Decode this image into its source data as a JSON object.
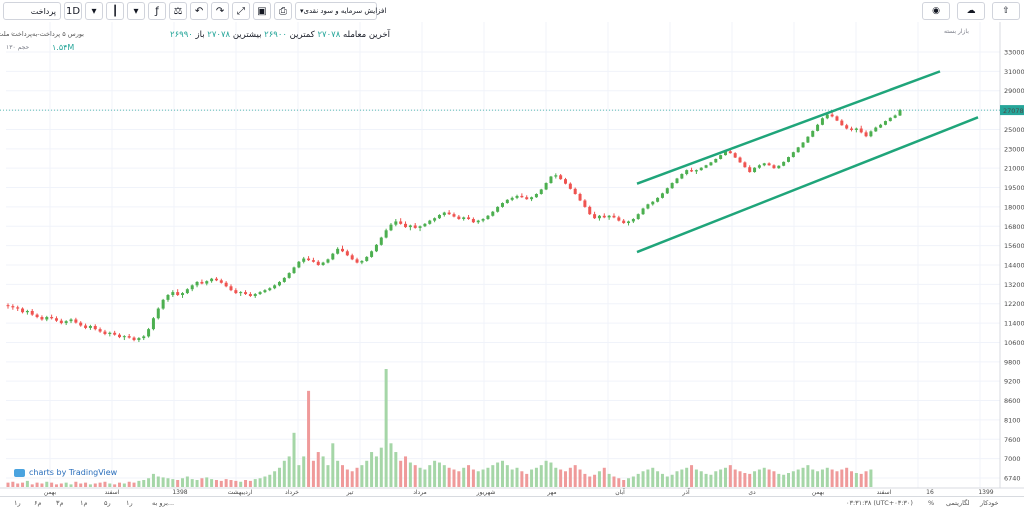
{
  "toolbar": {
    "symbol": "پرداخت",
    "interval": "1D",
    "indicators_label": "افزایش سرمایه و سود نقدی",
    "icons": [
      "chevron-down-icon",
      "candles-icon",
      "indicators-icon",
      "compare-icon",
      "undo-icon",
      "redo-icon",
      "fullscreen-icon",
      "save-icon",
      "print-icon",
      "camera-icon",
      "cloud-icon",
      "cloud-upload-icon"
    ]
  },
  "legend": {
    "symbol_title": "بورس ۵ پرداخت-به‌پرداخت ملت",
    "open_label": "باز",
    "open_value": "۲۶۹۹۰",
    "high_label": "بیشترین",
    "high_value": "۲۷۰۷۸",
    "low_label": "کمترین",
    "low_value": "۲۶۹۰۰",
    "close_label": "آخرین معامله",
    "close_value": "۲۷۰۷۸",
    "market_label": "بازار بسته",
    "volume_label": "حجم ۱۳۰",
    "volume_value": "۱.۵۴M"
  },
  "attribution": "charts by TradingView",
  "bottombar": {
    "ranges": [
      "۱ر",
      "۶م",
      "۳م",
      "۱م",
      "۵ر",
      "۱ر"
    ],
    "goto": "برو به...",
    "time": "۰۳:۳۱:۳۸ (UTC+۰۳:۳۰)",
    "percent": "%",
    "log": "لگاریتمی",
    "auto": "خودکار"
  },
  "chart_data": {
    "type": "candlestick",
    "y_ticks": [
      33000,
      31000,
      29000,
      27078,
      25000,
      23000,
      21000,
      19500,
      18000,
      16800,
      15600,
      14400,
      13200,
      12200,
      11400,
      10600,
      9800,
      9200,
      8600,
      8100,
      7600,
      7000,
      6740
    ],
    "last_price": 27078,
    "x_labels": [
      "بهمن",
      "اسفند",
      "1398",
      "اردیبهشت",
      "خرداد",
      "تیر",
      "مرداد",
      "شهریور",
      "مهر",
      "آبان",
      "آذر",
      "دی",
      "بهمن",
      "اسفند",
      "16",
      "1399"
    ],
    "candles": [
      [
        12140,
        12220,
        12000,
        12100
      ],
      [
        12100,
        12180,
        11950,
        12050
      ],
      [
        12050,
        12120,
        11900,
        12000
      ],
      [
        12000,
        12050,
        11800,
        11850
      ],
      [
        11850,
        11950,
        11750,
        11900
      ],
      [
        11900,
        11980,
        11700,
        11750
      ],
      [
        11750,
        11800,
        11600,
        11650
      ],
      [
        11650,
        11720,
        11500,
        11550
      ],
      [
        11550,
        11700,
        11480,
        11650
      ],
      [
        11650,
        11750,
        11550,
        11600
      ],
      [
        11600,
        11680,
        11450,
        11500
      ],
      [
        11500,
        11580,
        11350,
        11400
      ],
      [
        11400,
        11520,
        11320,
        11480
      ],
      [
        11480,
        11600,
        11400,
        11550
      ],
      [
        11550,
        11620,
        11380,
        11420
      ],
      [
        11420,
        11480,
        11250,
        11300
      ],
      [
        11300,
        11380,
        11150,
        11200
      ],
      [
        11200,
        11330,
        11120,
        11280
      ],
      [
        11280,
        11350,
        11100,
        11150
      ],
      [
        11150,
        11220,
        11000,
        11050
      ],
      [
        11050,
        11120,
        10900,
        10950
      ],
      [
        10950,
        11050,
        10850,
        11000
      ],
      [
        11000,
        11080,
        10880,
        10920
      ],
      [
        10920,
        10980,
        10780,
        10820
      ],
      [
        10820,
        10900,
        10700,
        10860
      ],
      [
        10860,
        10950,
        10760,
        10800
      ],
      [
        10800,
        10850,
        10650,
        10700
      ],
      [
        10700,
        10820,
        10620,
        10780
      ],
      [
        10780,
        10900,
        10700,
        10850
      ],
      [
        10850,
        11200,
        10800,
        11150
      ],
      [
        11150,
        11650,
        11100,
        11600
      ],
      [
        11600,
        12050,
        11550,
        12000
      ],
      [
        12000,
        12450,
        11950,
        12400
      ],
      [
        12400,
        12700,
        12300,
        12650
      ],
      [
        12650,
        12900,
        12550,
        12800
      ],
      [
        12800,
        12950,
        12600,
        12650
      ],
      [
        12650,
        12800,
        12500,
        12750
      ],
      [
        12750,
        13000,
        12700,
        12950
      ],
      [
        12950,
        13200,
        12850,
        13150
      ],
      [
        13150,
        13400,
        13050,
        13350
      ],
      [
        13350,
        13500,
        13200,
        13250
      ],
      [
        13250,
        13450,
        13150,
        13400
      ],
      [
        13400,
        13600,
        13300,
        13550
      ],
      [
        13550,
        13650,
        13400,
        13450
      ],
      [
        13450,
        13550,
        13250,
        13300
      ],
      [
        13300,
        13400,
        13050,
        13100
      ],
      [
        13100,
        13200,
        12850,
        12900
      ],
      [
        12900,
        13000,
        12700,
        12750
      ],
      [
        12750,
        12850,
        12600,
        12800
      ],
      [
        12800,
        12900,
        12650,
        12700
      ],
      [
        12700,
        12800,
        12550,
        12600
      ],
      [
        12600,
        12750,
        12500,
        12700
      ],
      [
        12700,
        12850,
        12650,
        12800
      ],
      [
        12800,
        12950,
        12750,
        12900
      ],
      [
        12900,
        13050,
        12850,
        13000
      ],
      [
        13000,
        13200,
        12950,
        13150
      ],
      [
        13150,
        13400,
        13100,
        13350
      ],
      [
        13350,
        13650,
        13300,
        13600
      ],
      [
        13600,
        13950,
        13550,
        13900
      ],
      [
        13900,
        14300,
        13850,
        14250
      ],
      [
        14250,
        14650,
        14200,
        14600
      ],
      [
        14600,
        14900,
        14500,
        14800
      ],
      [
        14800,
        14950,
        14650,
        14700
      ],
      [
        14700,
        14850,
        14550,
        14600
      ],
      [
        14600,
        14700,
        14350,
        14400
      ],
      [
        14400,
        14600,
        14350,
        14550
      ],
      [
        14550,
        14800,
        14500,
        14750
      ],
      [
        14750,
        15150,
        14700,
        15100
      ],
      [
        15100,
        15500,
        15050,
        15400
      ],
      [
        15400,
        15600,
        15200,
        15250
      ],
      [
        15250,
        15350,
        14950,
        15000
      ],
      [
        15000,
        15100,
        14700,
        14750
      ],
      [
        14750,
        14850,
        14500,
        14550
      ],
      [
        14550,
        14700,
        14450,
        14650
      ],
      [
        14650,
        14950,
        14600,
        14900
      ],
      [
        14900,
        15300,
        14850,
        15250
      ],
      [
        15250,
        15700,
        15200,
        15650
      ],
      [
        15650,
        16150,
        15600,
        16100
      ],
      [
        16100,
        16650,
        16050,
        16550
      ],
      [
        16550,
        17000,
        16500,
        16900
      ],
      [
        16900,
        17250,
        16800,
        17100
      ],
      [
        17100,
        17300,
        16900,
        16950
      ],
      [
        16950,
        17100,
        16700,
        16750
      ],
      [
        16750,
        16900,
        16550,
        16850
      ],
      [
        16850,
        17000,
        16650,
        16700
      ],
      [
        16700,
        16850,
        16500,
        16800
      ],
      [
        16800,
        17000,
        16750,
        16950
      ],
      [
        16950,
        17200,
        16900,
        17150
      ],
      [
        17150,
        17350,
        17050,
        17300
      ],
      [
        17300,
        17550,
        17250,
        17500
      ],
      [
        17500,
        17700,
        17400,
        17650
      ],
      [
        17650,
        17800,
        17500,
        17550
      ],
      [
        17550,
        17650,
        17350,
        17400
      ],
      [
        17400,
        17500,
        17200,
        17250
      ],
      [
        17250,
        17400,
        17150,
        17350
      ],
      [
        17350,
        17500,
        17200,
        17250
      ],
      [
        17250,
        17350,
        17000,
        17050
      ],
      [
        17050,
        17200,
        16950,
        17150
      ],
      [
        17150,
        17300,
        17050,
        17250
      ],
      [
        17250,
        17500,
        17200,
        17450
      ],
      [
        17450,
        17750,
        17400,
        17700
      ],
      [
        17700,
        18050,
        17650,
        18000
      ],
      [
        18000,
        18350,
        17950,
        18300
      ],
      [
        18300,
        18600,
        18250,
        18550
      ],
      [
        18550,
        18800,
        18450,
        18700
      ],
      [
        18700,
        18950,
        18600,
        18850
      ],
      [
        18850,
        19050,
        18700,
        18750
      ],
      [
        18750,
        18900,
        18550,
        18600
      ],
      [
        18600,
        18800,
        18450,
        18750
      ],
      [
        18750,
        19050,
        18700,
        19000
      ],
      [
        19000,
        19400,
        18950,
        19350
      ],
      [
        19350,
        19900,
        19300,
        19850
      ],
      [
        19850,
        20400,
        19800,
        20350
      ],
      [
        20350,
        20600,
        20200,
        20450
      ],
      [
        20450,
        20550,
        20100,
        20150
      ],
      [
        20150,
        20250,
        19750,
        19800
      ],
      [
        19800,
        19900,
        19350,
        19400
      ],
      [
        19400,
        19500,
        18950,
        19000
      ],
      [
        19000,
        19100,
        18450,
        18500
      ],
      [
        18500,
        18600,
        17950,
        18000
      ],
      [
        18000,
        18100,
        17500,
        17550
      ],
      [
        17550,
        17700,
        17250,
        17300
      ],
      [
        17300,
        17500,
        17150,
        17450
      ],
      [
        17450,
        17600,
        17300,
        17350
      ],
      [
        17350,
        17500,
        17200,
        17450
      ],
      [
        17450,
        17600,
        17300,
        17350
      ],
      [
        17350,
        17450,
        17100,
        17150
      ],
      [
        17150,
        17250,
        16950,
        17000
      ],
      [
        17000,
        17150,
        16850,
        17100
      ],
      [
        17100,
        17300,
        17000,
        17250
      ],
      [
        17250,
        17600,
        17200,
        17550
      ],
      [
        17550,
        17950,
        17500,
        17900
      ],
      [
        17900,
        18250,
        17850,
        18200
      ],
      [
        18200,
        18450,
        18100,
        18400
      ],
      [
        18400,
        18750,
        18350,
        18700
      ],
      [
        18700,
        19100,
        18650,
        19050
      ],
      [
        19050,
        19500,
        19000,
        19450
      ],
      [
        19450,
        19900,
        19400,
        19850
      ],
      [
        19850,
        20250,
        19800,
        20200
      ],
      [
        20200,
        20600,
        20150,
        20550
      ],
      [
        20550,
        20900,
        20450,
        20850
      ],
      [
        20850,
        21050,
        20700,
        20750
      ],
      [
        20750,
        20900,
        20550,
        20850
      ],
      [
        20850,
        21100,
        20800,
        21050
      ],
      [
        21050,
        21350,
        21000,
        21300
      ],
      [
        21300,
        21650,
        21250,
        21600
      ],
      [
        21600,
        22000,
        21550,
        21950
      ],
      [
        21950,
        22400,
        21900,
        22350
      ],
      [
        22350,
        22800,
        22300,
        22750
      ],
      [
        22750,
        23000,
        22500,
        22550
      ],
      [
        22550,
        22650,
        22050,
        22100
      ],
      [
        22100,
        22200,
        21550,
        21600
      ],
      [
        21600,
        21700,
        21050,
        21100
      ],
      [
        21100,
        21300,
        20650,
        20700
      ],
      [
        20700,
        21100,
        20650,
        21050
      ],
      [
        21050,
        21400,
        20950,
        21300
      ],
      [
        21300,
        21550,
        21200,
        21500
      ],
      [
        21500,
        21600,
        21250,
        21300
      ],
      [
        21300,
        21400,
        20950,
        21000
      ],
      [
        21000,
        21300,
        20950,
        21250
      ],
      [
        21250,
        21700,
        21200,
        21650
      ],
      [
        21650,
        22200,
        21600,
        22150
      ],
      [
        22150,
        22700,
        22100,
        22650
      ],
      [
        22650,
        23200,
        22600,
        23150
      ],
      [
        23150,
        23700,
        23100,
        23650
      ],
      [
        23650,
        24300,
        23600,
        24250
      ],
      [
        24250,
        24900,
        24200,
        24850
      ],
      [
        24850,
        25600,
        24800,
        25500
      ],
      [
        25500,
        26300,
        25450,
        26200
      ],
      [
        26200,
        26800,
        26100,
        26600
      ],
      [
        26600,
        26900,
        26300,
        26400
      ],
      [
        26400,
        26500,
        25900,
        25950
      ],
      [
        25950,
        26100,
        25400,
        25450
      ],
      [
        25450,
        25600,
        25000,
        25100
      ],
      [
        25100,
        25300,
        24800,
        24950
      ],
      [
        24950,
        25200,
        24700,
        25100
      ],
      [
        25100,
        25400,
        24600,
        24700
      ],
      [
        24700,
        24900,
        24200,
        24300
      ],
      [
        24300,
        24900,
        24200,
        24800
      ],
      [
        24800,
        25300,
        24750,
        25200
      ],
      [
        25200,
        25600,
        25150,
        25500
      ],
      [
        25500,
        25950,
        25450,
        25900
      ],
      [
        25900,
        26300,
        25850,
        26250
      ],
      [
        26250,
        26600,
        26200,
        26500
      ],
      [
        26500,
        27200,
        26450,
        27078
      ]
    ],
    "volumes": [
      0.05,
      0.06,
      0.04,
      0.05,
      0.07,
      0.03,
      0.05,
      0.04,
      0.06,
      0.05,
      0.03,
      0.04,
      0.05,
      0.03,
      0.06,
      0.04,
      0.05,
      0.03,
      0.04,
      0.05,
      0.06,
      0.04,
      0.03,
      0.05,
      0.04,
      0.06,
      0.05,
      0.07,
      0.08,
      0.1,
      0.15,
      0.12,
      0.11,
      0.1,
      0.09,
      0.08,
      0.1,
      0.12,
      0.09,
      0.08,
      0.1,
      0.11,
      0.09,
      0.08,
      0.07,
      0.09,
      0.08,
      0.07,
      0.06,
      0.08,
      0.07,
      0.09,
      0.1,
      0.12,
      0.14,
      0.18,
      0.22,
      0.3,
      0.35,
      0.62,
      0.25,
      0.35,
      1.1,
      0.3,
      0.4,
      0.35,
      0.25,
      0.5,
      0.3,
      0.25,
      0.2,
      0.18,
      0.22,
      0.25,
      0.3,
      0.4,
      0.35,
      0.45,
      1.35,
      0.5,
      0.4,
      0.3,
      0.35,
      0.28,
      0.25,
      0.22,
      0.2,
      0.25,
      0.3,
      0.28,
      0.25,
      0.22,
      0.2,
      0.18,
      0.22,
      0.25,
      0.2,
      0.18,
      0.2,
      0.22,
      0.25,
      0.28,
      0.3,
      0.25,
      0.2,
      0.22,
      0.18,
      0.15,
      0.2,
      0.22,
      0.25,
      0.3,
      0.28,
      0.22,
      0.2,
      0.18,
      0.22,
      0.25,
      0.2,
      0.15,
      0.12,
      0.14,
      0.18,
      0.22,
      0.15,
      0.12,
      0.1,
      0.08,
      0.1,
      0.12,
      0.15,
      0.18,
      0.2,
      0.22,
      0.18,
      0.15,
      0.12,
      0.14,
      0.18,
      0.2,
      0.22,
      0.25,
      0.2,
      0.18,
      0.15,
      0.14,
      0.18,
      0.2,
      0.22,
      0.25,
      0.2,
      0.18,
      0.16,
      0.15,
      0.18,
      0.2,
      0.22,
      0.2,
      0.18,
      0.15,
      0.14,
      0.16,
      0.18,
      0.2,
      0.22,
      0.25,
      0.2,
      0.18,
      0.2,
      0.22,
      0.2,
      0.18,
      0.2,
      0.22,
      0.18,
      0.16,
      0.15,
      0.18,
      0.2
    ],
    "channel_upper": [
      [
        20,
        19800
      ],
      [
        54,
        31000
      ]
    ],
    "channel_lower": [
      [
        20,
        15200
      ],
      [
        57,
        26300
      ]
    ]
  },
  "colors": {
    "up": "#26a69a",
    "up_candle": "#4caf50",
    "down": "#ef5350",
    "vol_up": "#a5d6a7",
    "vol_down": "#ef9a9a",
    "channel": "#1fa57a",
    "last_price_bg": "#26a69a"
  }
}
